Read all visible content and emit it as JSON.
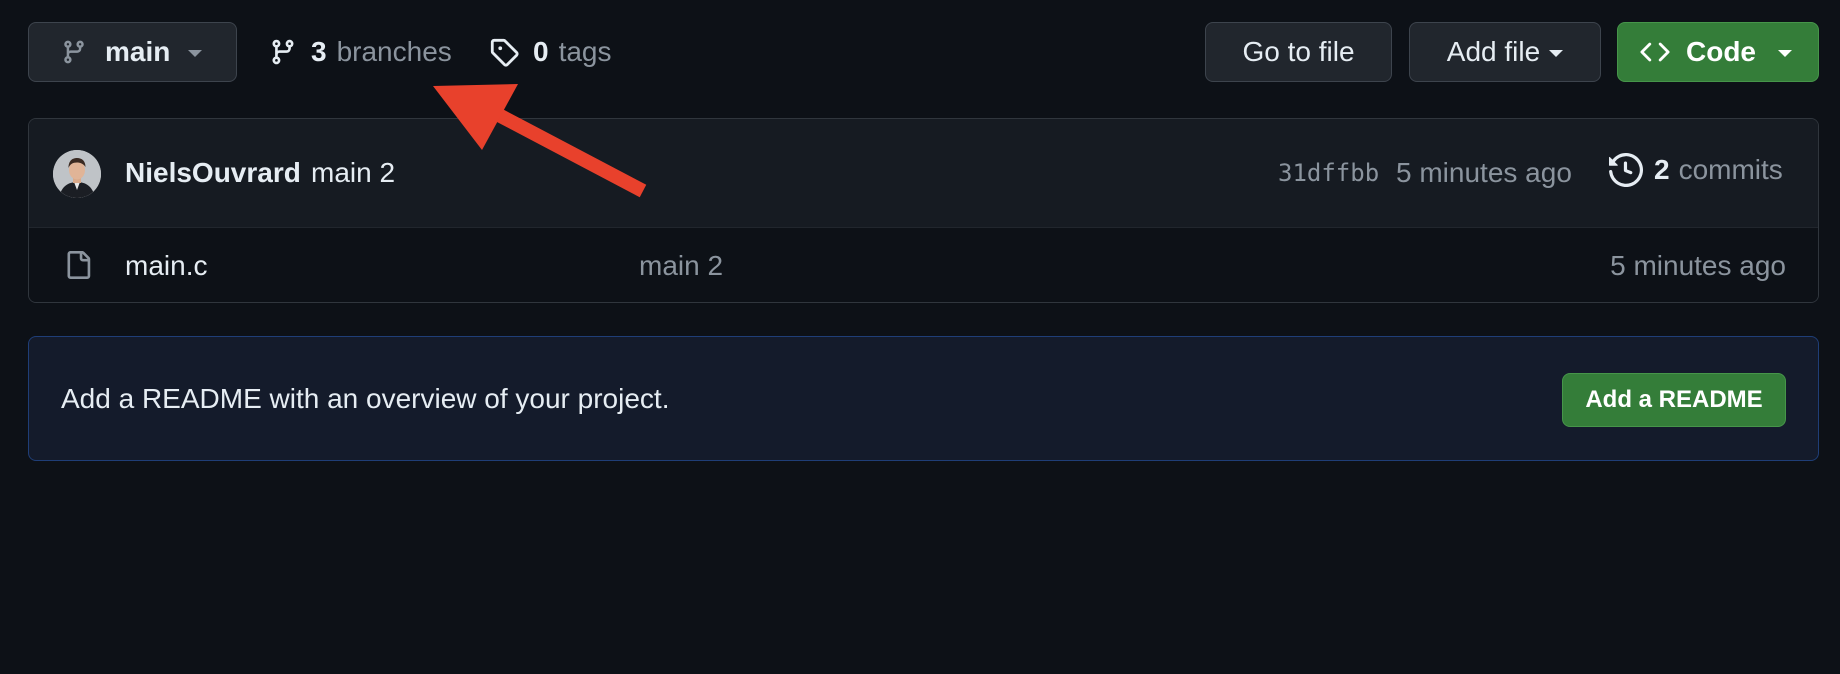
{
  "toolbar": {
    "branch_selector": {
      "label": "main",
      "icon": "git-branch-icon"
    },
    "branches": {
      "count": "3",
      "label": "branches",
      "icon": "git-branch-icon"
    },
    "tags": {
      "count": "0",
      "label": "tags",
      "icon": "tag-icon"
    },
    "go_to_file_label": "Go to file",
    "add_file_label": "Add file",
    "code_label": "Code",
    "code_icon": "code-icon"
  },
  "latest_commit": {
    "author": "NielsOuvrard",
    "message": "main 2",
    "sha": "31dffbb",
    "time": "5 minutes ago",
    "commits_count": "2",
    "commits_label": "commits",
    "history_icon": "history-icon"
  },
  "files": [
    {
      "name": "main.c",
      "commit_message": "main 2",
      "time": "5 minutes ago",
      "icon": "file-icon"
    }
  ],
  "readme_banner": {
    "text": "Add a README with an overview of your project.",
    "button_label": "Add a README"
  },
  "colors": {
    "background": "#0d1117",
    "primary_button": "#347d39",
    "annotation_arrow": "#e8412c",
    "muted_text": "#8b949e"
  }
}
